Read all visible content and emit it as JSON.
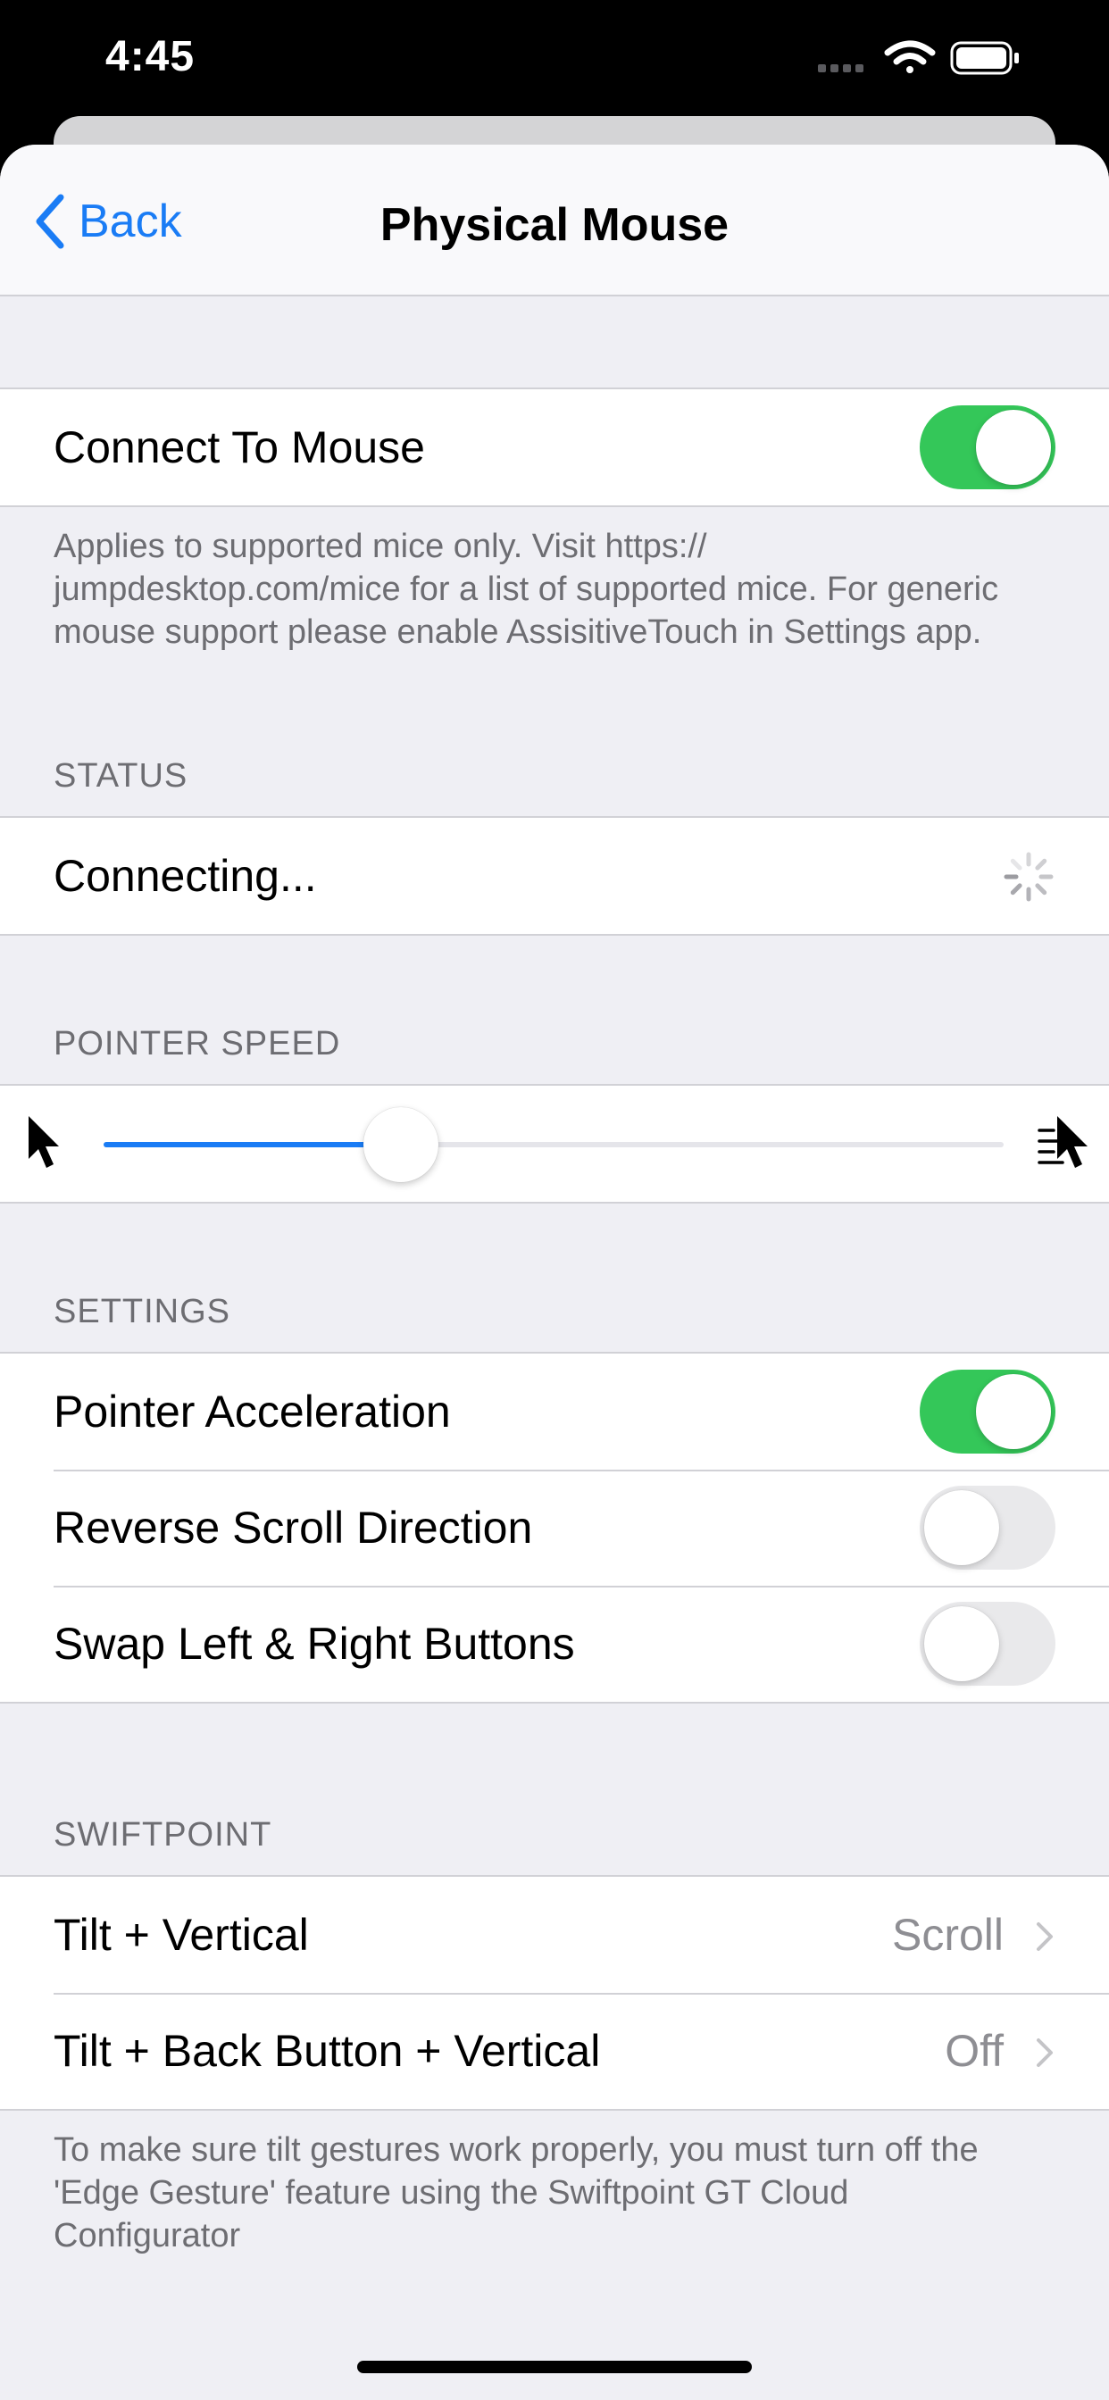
{
  "status_bar": {
    "time": "4:45"
  },
  "nav": {
    "back_label": "Back",
    "title": "Physical Mouse"
  },
  "connect": {
    "label": "Connect To Mouse",
    "enabled": true,
    "footer": "Applies to supported mice only. Visit https:// jumpdesktop.com/mice for a list of supported mice. For generic mouse support please enable AssisitiveTouch in Settings app."
  },
  "status": {
    "header": "STATUS",
    "text": "Connecting..."
  },
  "pointer_speed": {
    "header": "POINTER SPEED",
    "value": 0.33
  },
  "settings": {
    "header": "SETTINGS",
    "items": [
      {
        "label": "Pointer Acceleration",
        "on": true
      },
      {
        "label": "Reverse Scroll Direction",
        "on": false
      },
      {
        "label": "Swap Left & Right Buttons",
        "on": false
      }
    ]
  },
  "swiftpoint": {
    "header": "SWIFTPOINT",
    "items": [
      {
        "label": "Tilt + Vertical",
        "value": "Scroll"
      },
      {
        "label": "Tilt + Back Button + Vertical",
        "value": "Off"
      }
    ],
    "footer": "To make sure tilt gestures work properly, you must turn off the 'Edge Gesture' feature using the Swiftpoint GT Cloud Configurator"
  },
  "colors": {
    "accent": "#1a7cf5",
    "toggle_on": "#34c759",
    "toggle_off": "#e9e9eb",
    "background": "#efeff4"
  }
}
